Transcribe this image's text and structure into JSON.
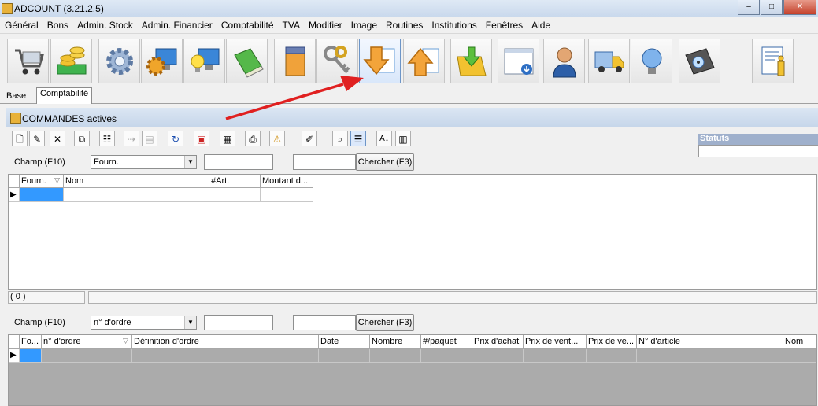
{
  "window": {
    "title": "ADCOUNT (3.21.2.5)",
    "min": "–",
    "max": "□",
    "close": "✕"
  },
  "menu": [
    "Général",
    "Bons",
    "Admin. Stock",
    "Admin. Financier",
    "Comptabilité",
    "TVA",
    "Modifier",
    "Image",
    "Routines",
    "Institutions",
    "Fenêtres",
    "Aide"
  ],
  "toolbar_icons": [
    "shopping-cart-icon",
    "coins-icon",
    "gear-icon",
    "gear-monitor-icon",
    "lightbulb-monitor-icon",
    "green-book-icon",
    "jar-icon",
    "keys-icon",
    "arrow-down-icon",
    "arrow-up-icon",
    "import-icon",
    "download-window-icon",
    "user-icon",
    "truck-icon",
    "bulb-icon",
    "disk-icon",
    "info-icon"
  ],
  "tabs": {
    "base": "Base",
    "compta": "Comptabilité"
  },
  "inner": {
    "title": "COMMANDES actives",
    "statuts_label": "Statuts",
    "top": {
      "field_label": "Champ (F10)",
      "combo_value": "Fourn.",
      "search_button": "Chercher (F3)",
      "columns": [
        "Fourn.",
        "Nom",
        "#Art.",
        "Montant d..."
      ],
      "count": "( 0 )"
    },
    "bottom": {
      "field_label": "Champ (F10)",
      "combo_value": "n° d'ordre",
      "search_button": "Chercher (F3)",
      "columns": [
        "Fo...",
        "n° d'ordre",
        "Définition d'ordre",
        "Date",
        "Nombre",
        "#/paquet",
        "Prix d'achat",
        "Prix de vent...",
        "Prix de ve...",
        "N° d'article",
        "Nom"
      ]
    }
  },
  "colors": {
    "annotation_arrow": "#e02020",
    "statuts_header": "#9fb0cc",
    "selected_cell": "#3399ff"
  }
}
